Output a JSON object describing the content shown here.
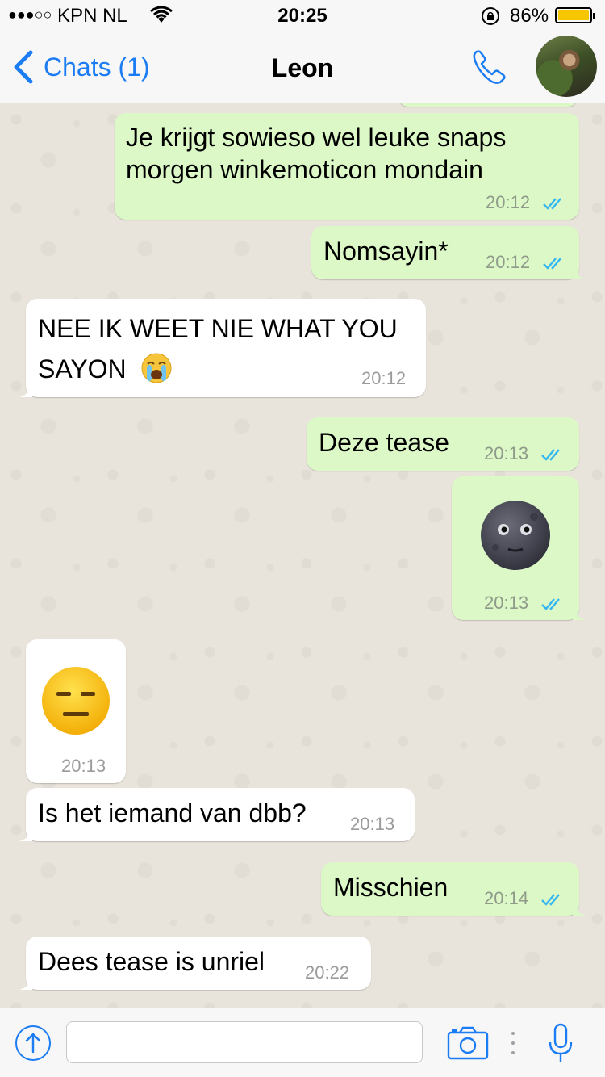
{
  "status_bar": {
    "signal_dots": "●●●○○",
    "carrier": "KPN NL",
    "time": "20:25",
    "battery_percent": "86%",
    "battery_color": "#f6c602"
  },
  "nav": {
    "back_label": "Chats (1)",
    "title": "Leon",
    "accent_color": "#1b7cf3"
  },
  "messages": [
    {
      "dir": "out",
      "text_lines": [
        "Je krijgt sowieso wel leuke snaps",
        "morgen winkemoticon mondain"
      ],
      "time": "20:12",
      "read": true
    },
    {
      "dir": "out",
      "text": "Nomsayin*",
      "time": "20:12",
      "read": true
    },
    {
      "dir": "in",
      "text_lines": [
        "NEE IK WEET NIE WHAT YOU",
        "SAYON"
      ],
      "emoji": "loudly-crying-face",
      "time": "20:12"
    },
    {
      "dir": "out",
      "text": "Deze tease",
      "time": "20:13",
      "read": true
    },
    {
      "dir": "out",
      "emoji": "new-moon-face",
      "time": "20:13",
      "read": true
    },
    {
      "dir": "in",
      "emoji": "expressionless-face",
      "time": "20:13"
    },
    {
      "dir": "in",
      "text": "Is het iemand van dbb?",
      "time": "20:13"
    },
    {
      "dir": "out",
      "text": "Misschien",
      "time": "20:14",
      "read": true
    },
    {
      "dir": "in",
      "text": "Dees tease is unriel",
      "time": "20:22"
    }
  ],
  "input_bar": {
    "message_value": "",
    "icons": [
      "share-icon",
      "camera-icon",
      "microphone-icon"
    ]
  },
  "colors": {
    "outgoing_bubble": "#dcf8c6",
    "incoming_bubble": "#ffffff",
    "read_ticks": "#34b7f1",
    "chat_background": "#e8e3db"
  }
}
